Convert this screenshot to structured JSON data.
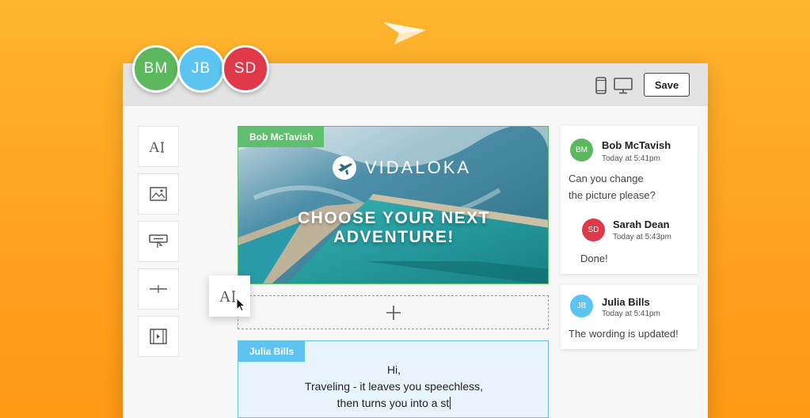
{
  "collaborators": [
    {
      "initials": "BM",
      "color": "#5cb85c"
    },
    {
      "initials": "JB",
      "color": "#5bc4f1"
    },
    {
      "initials": "SD",
      "color": "#e0394a"
    }
  ],
  "toolbar": {
    "save_label": "Save",
    "icons": [
      "mobile-icon",
      "desktop-icon"
    ]
  },
  "tools": [
    {
      "name": "text-tool",
      "icon": "text-icon"
    },
    {
      "name": "image-tool",
      "icon": "image-icon"
    },
    {
      "name": "button-tool",
      "icon": "button-icon"
    },
    {
      "name": "divider-tool",
      "icon": "divider-icon"
    },
    {
      "name": "video-tool",
      "icon": "video-icon"
    }
  ],
  "canvas": {
    "hero_block": {
      "author_tag": "Bob McTavish",
      "brand": "VIDALOKA",
      "headline": "CHOOSE YOUR NEXT ADVENTURE!"
    },
    "text_block": {
      "author_tag": "Julia Bills",
      "line1": "Hi,",
      "line2": "Traveling - it leaves you speechless,",
      "line3": "then turns you into a st"
    }
  },
  "comments": [
    {
      "author": "Bob McTavish",
      "initials": "BM",
      "color": "#5cb85c",
      "time": "Today at 5:41pm",
      "line1": "Can you change",
      "line2": "the picture please?",
      "reply": {
        "author": "Sarah Dean",
        "initials": "SD",
        "color": "#e0394a",
        "time": "Today at 5:43pm",
        "text": "Done!"
      }
    },
    {
      "author": "Julia Bills",
      "initials": "JB",
      "color": "#5bc4f1",
      "time": "Today at 5:41pm",
      "text": "The wording is updated!"
    }
  ],
  "colors": {
    "background": "#ffa726",
    "hero_tag": "#5fbf6e",
    "text_tag": "#5ec4ef"
  }
}
